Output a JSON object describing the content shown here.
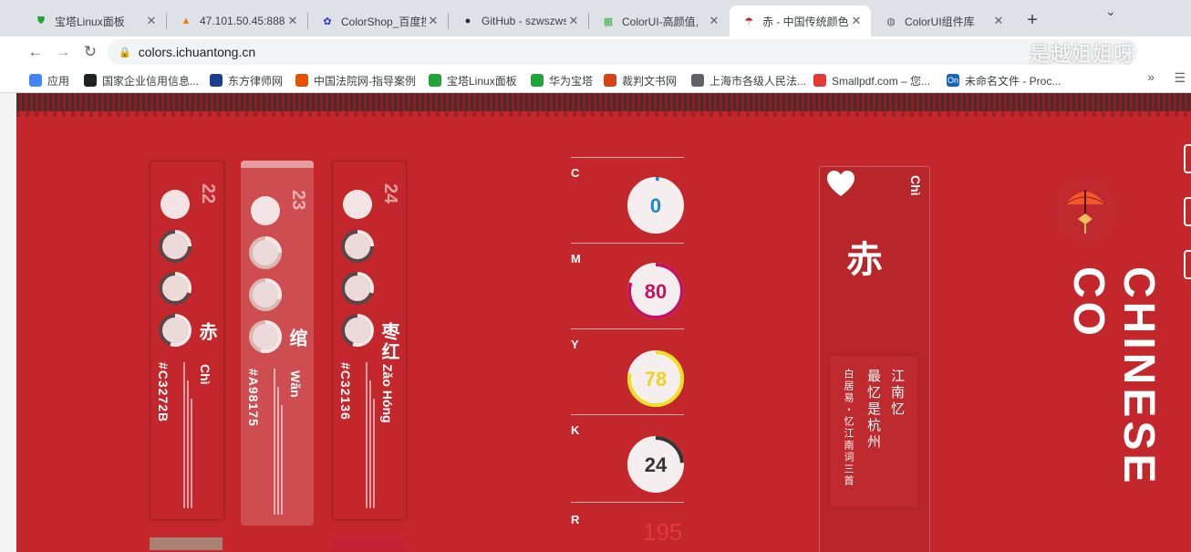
{
  "browser": {
    "tabs": [
      {
        "title": "宝塔Linux面板",
        "icon": "shield-icon",
        "icon_color": "#20a53a"
      },
      {
        "title": "47.101.50.45:888",
        "icon": "chart-icon",
        "icon_color": "#f57c00"
      },
      {
        "title": "ColorShop_百度搜",
        "icon": "paw-icon",
        "icon_color": "#2932e1"
      },
      {
        "title": "GitHub - szwszws",
        "icon": "github-icon",
        "icon_color": "#24292e"
      },
      {
        "title": "ColorUI-高颜值,",
        "icon": "grid-icon",
        "icon_color": "#39b54a"
      },
      {
        "title": "赤 - 中国传统颜色",
        "icon": "umbrella-icon",
        "icon_color": "#c3272b",
        "active": true
      },
      {
        "title": "ColorUI组件库",
        "icon": "globe-icon",
        "icon_color": "#5f6368"
      }
    ],
    "close_glyph": "✕",
    "new_tab_glyph": "+",
    "url": "colors.ichuantong.cn",
    "watermark": "是越姐姐呀",
    "bookmarks": [
      {
        "label": "应用",
        "icon_color": "#4285f4"
      },
      {
        "label": "国家企业信用信息...",
        "icon_color": "#202124"
      },
      {
        "label": "东方律师网",
        "icon_color": "#1a3d8f"
      },
      {
        "label": "中国法院网-指导案例",
        "icon_color": "#e65100"
      },
      {
        "label": "宝塔Linux面板",
        "icon_color": "#20a53a"
      },
      {
        "label": "华为宝塔",
        "icon_color": "#20a53a"
      },
      {
        "label": "裁判文书网",
        "icon_color": "#d84315"
      },
      {
        "label": "上海市各级人民法...",
        "icon_color": "#5f6368"
      },
      {
        "label": "Smallpdf.com – 您...",
        "icon_color": "#e53935"
      },
      {
        "label": "未命名文件 - Proc...",
        "icon_color": "#1565c0",
        "icon_text": "On"
      }
    ],
    "bookmarks_more": "»"
  },
  "colors": [
    {
      "index": "22",
      "name": "赤",
      "pinyin": "Chì",
      "hex": "#C3272B",
      "selected": false
    },
    {
      "index": "23",
      "name": "绾",
      "pinyin": "Wǎn",
      "hex": "#A98175",
      "selected": true
    },
    {
      "index": "24",
      "name": "枣红",
      "pinyin": "Zǎo Hóng",
      "hex": "#C32136",
      "selected": false
    }
  ],
  "cmyk": [
    {
      "label": "C",
      "value": 0,
      "color": "#1e88c8"
    },
    {
      "label": "M",
      "value": 80,
      "color": "#c4125f"
    },
    {
      "label": "Y",
      "value": 78,
      "color": "#f0e020"
    },
    {
      "label": "K",
      "value": 24,
      "color": "#333333"
    }
  ],
  "rgb": {
    "r_label": "R",
    "r_value": "195"
  },
  "detail": {
    "pinyin": "Chì",
    "char": "赤",
    "poem_title": "江南忆",
    "poem_line": "最忆是杭州",
    "poem_author": "白居易・忆江南词三首"
  },
  "brand": "CHINESE CO",
  "theme": {
    "page_bg": "#c3272b"
  }
}
